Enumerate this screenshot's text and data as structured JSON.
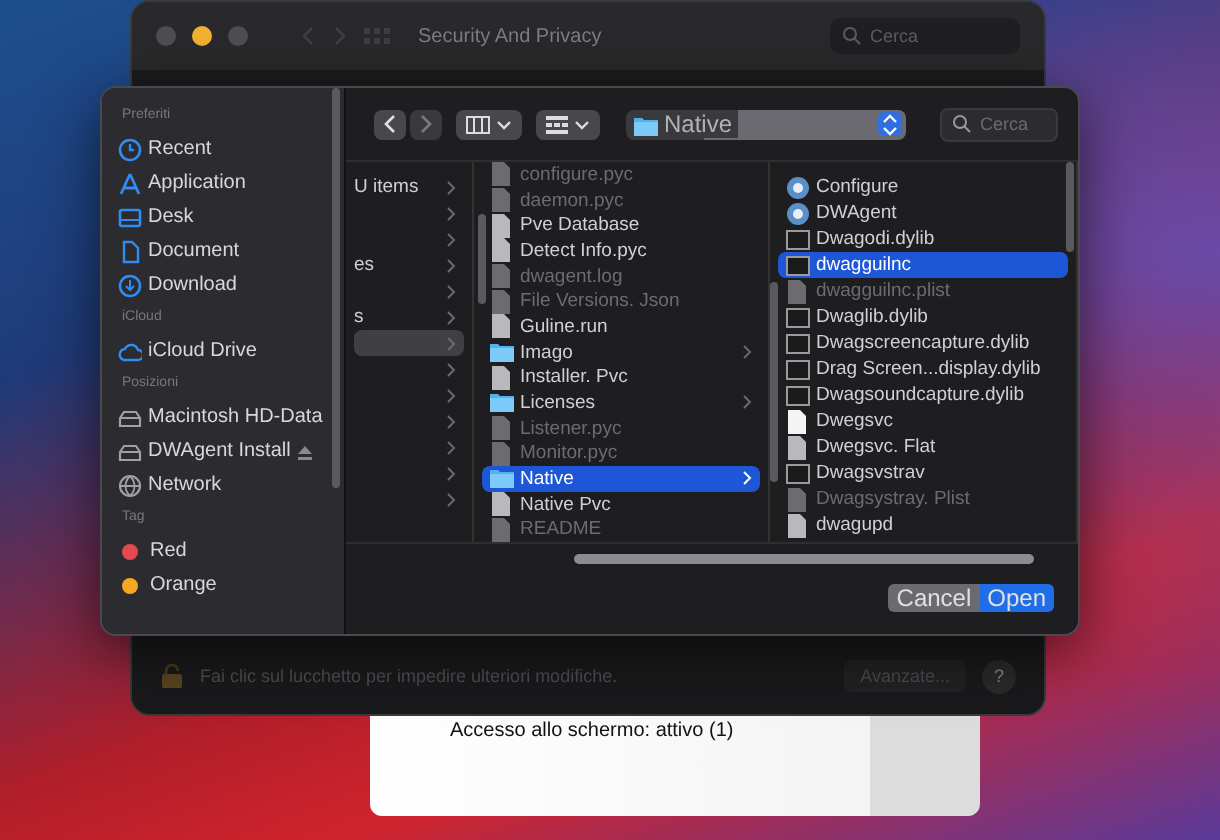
{
  "back_window": {
    "title": "Security And Privacy",
    "search": {
      "placeholder": "Cerca"
    },
    "lock_text": "Fai clic sul lucchetto per impedire ulteriori modifiche.",
    "advanced_button": "Avanzate...",
    "help_button": "?"
  },
  "note_panel": {
    "text": "Accesso allo schermo: attivo (1)"
  },
  "dialog": {
    "sidebar": {
      "sections": [
        {
          "heading": "Preferiti",
          "items": [
            {
              "label": "Recent",
              "kind": "clock"
            },
            {
              "label": "Application",
              "kind": "apps"
            },
            {
              "label": "Desk",
              "kind": "desktop"
            },
            {
              "label": "Document",
              "kind": "doc"
            },
            {
              "label": "Download",
              "kind": "download"
            }
          ]
        },
        {
          "heading": "iCloud",
          "items": [
            {
              "label": "iCloud Drive",
              "kind": "cloud"
            }
          ]
        },
        {
          "heading": "Posizioni",
          "items": [
            {
              "label": "Macintosh HD-Data",
              "kind": "disk",
              "ejectable": false
            },
            {
              "label": "DWAgent Install",
              "kind": "disk",
              "ejectable": true
            },
            {
              "label": "Network",
              "kind": "globe",
              "ejectable": false
            }
          ]
        },
        {
          "heading": "Tag",
          "items": [
            {
              "label": "Red",
              "kind": "tag",
              "color": "#e5484d"
            },
            {
              "label": "Orange",
              "kind": "tag",
              "color": "#f5a623"
            }
          ]
        }
      ]
    },
    "toolbar": {
      "path": "Native",
      "search": {
        "placeholder": "Cerca"
      }
    },
    "columns": [
      {
        "rows": [
          {
            "label": "U items",
            "selected": false
          },
          {
            "selected": false
          },
          {
            "selected": false
          },
          {
            "label": "es",
            "selected": false
          },
          {
            "selected": false
          },
          {
            "label": "s",
            "selected": false
          },
          {
            "selected": true
          },
          {
            "selected": false
          },
          {
            "selected": false
          },
          {
            "selected": false
          },
          {
            "selected": false
          },
          {
            "selected": false
          },
          {
            "selected": false
          }
        ]
      },
      {
        "rows": [
          {
            "label": "configure.pyc",
            "kind": "file",
            "selected": false,
            "disabled": true
          },
          {
            "label": "daemon.pyc",
            "kind": "file",
            "selected": false,
            "disabled": true
          },
          {
            "label": "Pve Database",
            "kind": "file",
            "selected": false,
            "disabled": false
          },
          {
            "label": "Detect Info.pyc",
            "kind": "file",
            "selected": false,
            "disabled": false
          },
          {
            "label": "dwagent.log",
            "kind": "file",
            "selected": false,
            "disabled": true
          },
          {
            "label": "File Versions. Json",
            "kind": "file",
            "selected": false,
            "disabled": true
          },
          {
            "label": "Guline.run",
            "kind": "file",
            "selected": false,
            "disabled": false
          },
          {
            "label": "Imago",
            "kind": "folder",
            "selected": false,
            "disabled": false
          },
          {
            "label": "Installer. Pvc",
            "kind": "file",
            "selected": false,
            "disabled": false
          },
          {
            "label": "Licenses",
            "kind": "folder",
            "selected": false,
            "disabled": false
          },
          {
            "label": "Listener.pyc",
            "kind": "file",
            "selected": false,
            "disabled": true
          },
          {
            "label": "Monitor.pyc",
            "kind": "file",
            "selected": false,
            "disabled": true
          },
          {
            "label": "Native",
            "kind": "folder",
            "selected": true,
            "disabled": false
          },
          {
            "label": "Native Pvc",
            "kind": "file",
            "selected": false,
            "disabled": false
          },
          {
            "label": "README",
            "kind": "file",
            "selected": false,
            "disabled": true
          }
        ]
      },
      {
        "rows": [
          {
            "label": "Configure",
            "kind": "app",
            "selected": false,
            "disabled": false
          },
          {
            "label": "DWAgent",
            "kind": "app",
            "selected": false,
            "disabled": false
          },
          {
            "label": "Dwagodi.dylib",
            "kind": "exec",
            "selected": false,
            "disabled": false
          },
          {
            "label": "dwagguilnc",
            "kind": "exec",
            "selected": true,
            "disabled": false
          },
          {
            "label": "dwagguilnc.plist",
            "kind": "file",
            "selected": false,
            "disabled": true
          },
          {
            "label": "Dwaglib.dylib",
            "kind": "exec",
            "selected": false,
            "disabled": false
          },
          {
            "label": "Dwagscreencapture.dylib",
            "kind": "exec",
            "selected": false,
            "disabled": false
          },
          {
            "label": "Drag Screen...display.dylib",
            "kind": "exec",
            "selected": false,
            "disabled": false
          },
          {
            "label": "Dwagsoundcapture.dylib",
            "kind": "exec",
            "selected": false,
            "disabled": false
          },
          {
            "label": "Dwegsvc",
            "kind": "doc",
            "selected": false,
            "disabled": false
          },
          {
            "label": "Dwegsvc. Flat",
            "kind": "file",
            "selected": false,
            "disabled": false
          },
          {
            "label": "Dwagsvstrav",
            "kind": "exec",
            "selected": false,
            "disabled": false
          },
          {
            "label": "Dwagsystray. Plist",
            "kind": "file",
            "selected": false,
            "disabled": true
          },
          {
            "label": "dwagupd",
            "kind": "file",
            "selected": false,
            "disabled": false
          }
        ]
      }
    ],
    "buttons": [
      {
        "label": "Cancel",
        "kind": "secondary"
      },
      {
        "label": "Open",
        "kind": "primary"
      }
    ]
  }
}
